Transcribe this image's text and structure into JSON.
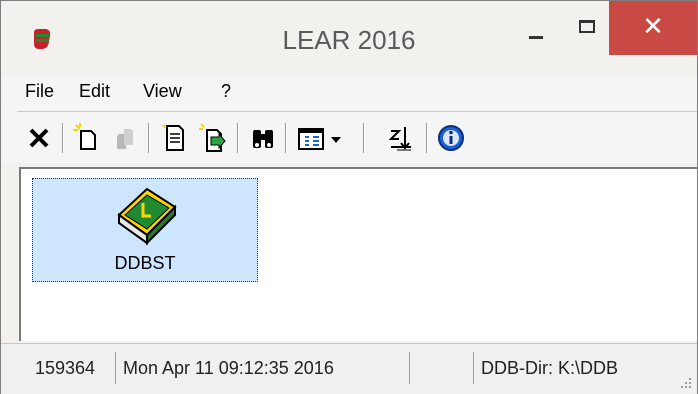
{
  "window": {
    "title": "LEAR 2016"
  },
  "titlebar": {
    "close_glyph": "✕",
    "app_icon": "app-icon"
  },
  "menu": {
    "items": [
      "File",
      "Edit",
      "View",
      "?"
    ]
  },
  "toolbar": {
    "buttons": [
      "delete-icon",
      "new-document-icon",
      "copy-icon",
      "document-icon",
      "new-document-arrow-icon",
      "binoculars-icon",
      "grid-view-icon",
      "dropdown-arrow-icon",
      "sort-icon",
      "info-icon"
    ]
  },
  "content": {
    "items": [
      {
        "label": "DDBST",
        "icon": "book-icon"
      }
    ]
  },
  "status": {
    "count": "159364",
    "datetime": "Mon Apr 11 09:12:35 2016",
    "empty": "",
    "ddb_dir": "DDB-Dir:  K:\\DDB"
  },
  "colors": {
    "close_button": "#c94a45",
    "selection": "#cde5ff",
    "info_blue": "#1a62d6"
  }
}
